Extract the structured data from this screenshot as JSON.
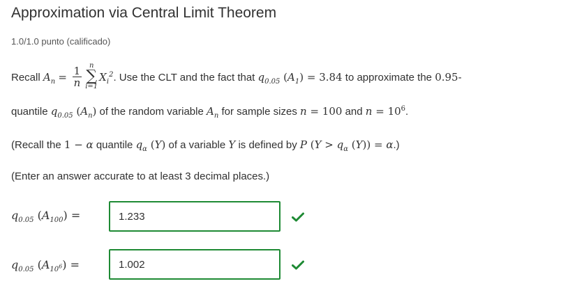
{
  "title": "Approximation via Central Limit Theorem",
  "score": "1.0/1.0 punto (calificado)",
  "problem": {
    "recall_word": "Recall",
    "text_use": ". Use the CLT and the fact that",
    "value_384": "3.84",
    "text_approx": "to approximate the",
    "value_095": "0.95",
    "text_quantile": "quantile",
    "text_of_rv": "of the random variable",
    "text_sample_sizes": "for sample sizes",
    "value_100": "100",
    "text_and": "and",
    "value_10": "10",
    "value_exp6": "6"
  },
  "recall_note": {
    "open": "(Recall the",
    "one": "1",
    "text_quantile": "quantile",
    "text_of_var": "of a variable",
    "text_defined": "is defined by",
    "close": ".)"
  },
  "instruction": "(Enter an answer accurate to at least 3 decimal places.)",
  "answers": [
    {
      "value": "1.233",
      "status": "correct"
    },
    {
      "value": "1.002",
      "status": "correct"
    }
  ],
  "colors": {
    "correct": "#1e8a34",
    "text": "#313131"
  }
}
